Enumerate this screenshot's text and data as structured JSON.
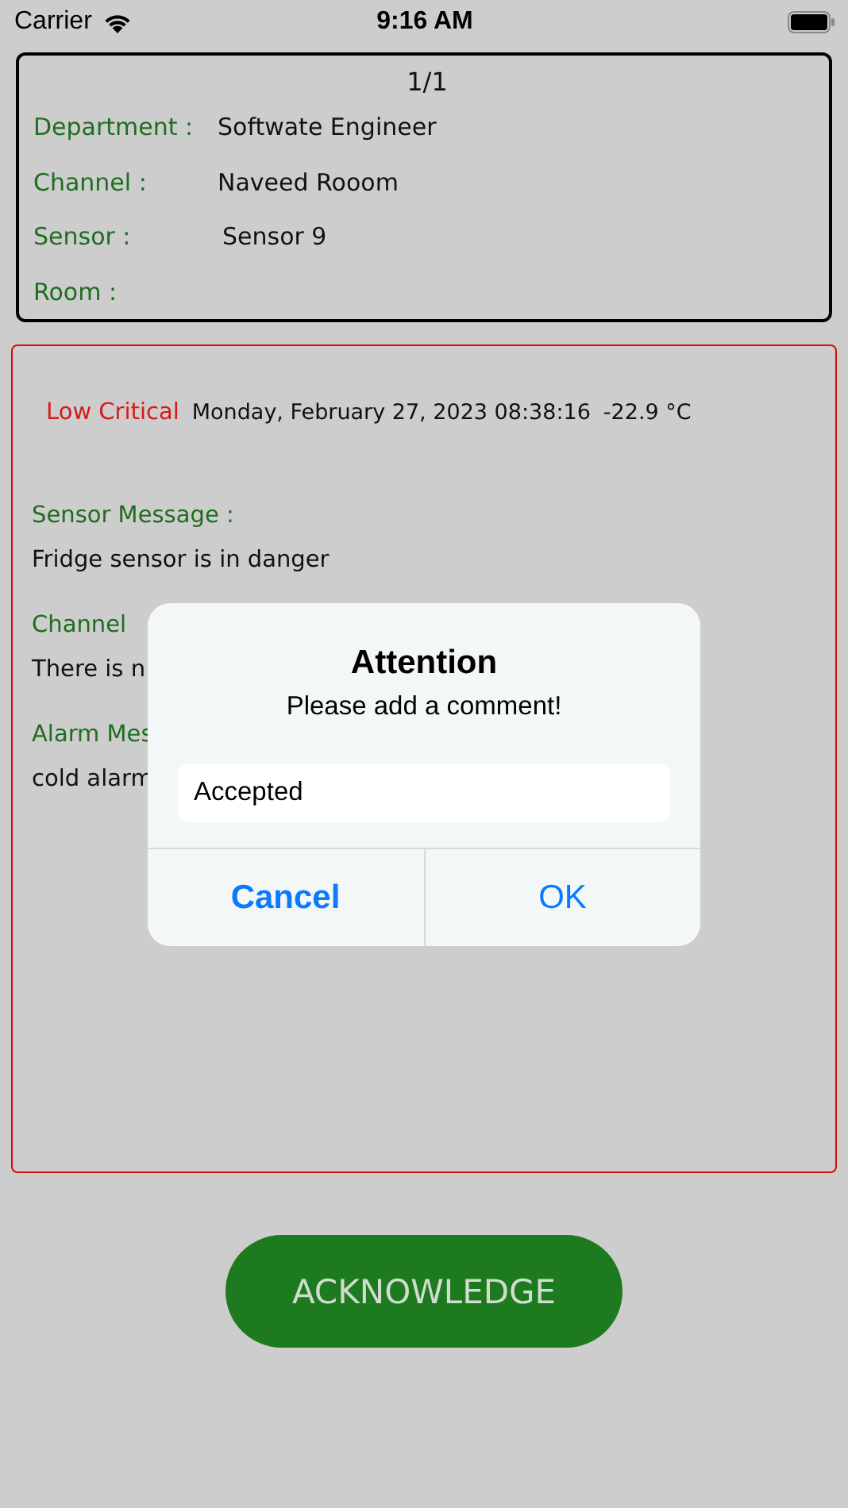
{
  "status_bar": {
    "carrier": "Carrier",
    "time": "9:16 AM"
  },
  "header_card": {
    "counter": "1/1",
    "fields": [
      {
        "label": "Department :",
        "value": "Softwate Engineer"
      },
      {
        "label": "Channel :",
        "value": "Naveed Rooom"
      },
      {
        "label": "Sensor :",
        "value": "Sensor 9"
      },
      {
        "label": "Room  :"
      }
    ]
  },
  "alarm": {
    "severity": "Low Critical",
    "timestamp": "Monday, February 27, 2023 08:38:16",
    "reading": "-22.9 °C",
    "sections": [
      {
        "heading": "Sensor Message :",
        "body": "Fridge sensor is in danger"
      },
      {
        "heading": "Channel",
        "body": "There is n"
      },
      {
        "heading": "Alarm Mes",
        "body": "cold alarm"
      }
    ]
  },
  "acknowledge_button": {
    "label": "ACKNOWLEDGE"
  },
  "dialog": {
    "title": "Attention",
    "message": "Please add a comment!",
    "input": {
      "value": "Accepted"
    },
    "buttons": [
      {
        "label": "Cancel",
        "kind": "cancel"
      },
      {
        "label": "OK",
        "kind": "default"
      }
    ]
  }
}
